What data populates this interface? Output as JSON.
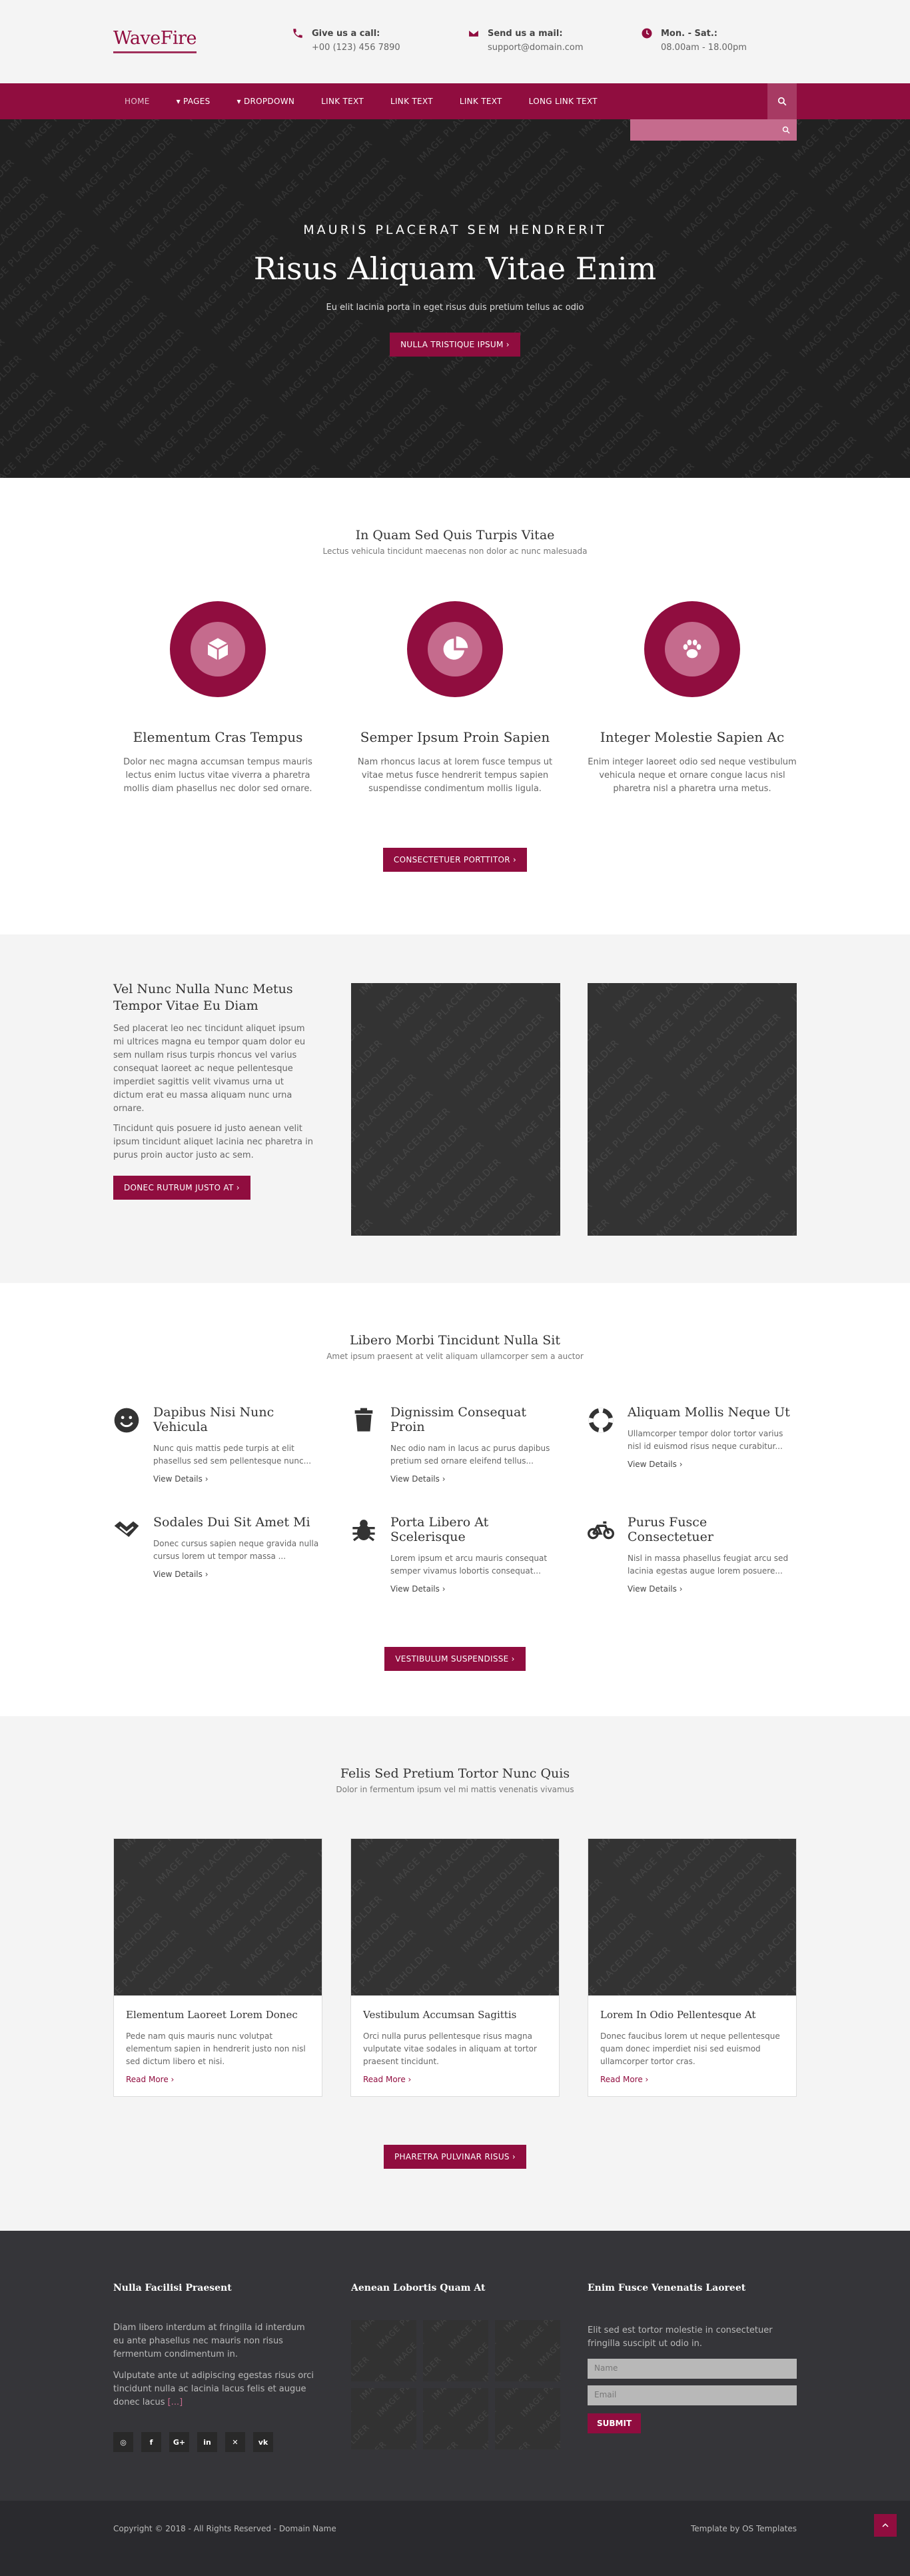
{
  "header": {
    "logo": "WaveFire",
    "contacts": [
      {
        "title": "Give us a call:",
        "value": "+00 (123) 456 7890"
      },
      {
        "title": "Send us a mail:",
        "value": "support@domain.com"
      },
      {
        "title": "Mon. - Sat.:",
        "value": "08.00am - 18.00pm"
      }
    ]
  },
  "nav": {
    "items": [
      "HOME",
      "▾ PAGES",
      "▾ DROPDOWN",
      "LINK TEXT",
      "LINK TEXT",
      "LINK TEXT",
      "LONG LINK TEXT"
    ]
  },
  "placeholder": {
    "text": "IMAGE PLACEHOLDER"
  },
  "hero": {
    "kicker": "MAURIS PLACERAT SEM HENDRERIT",
    "title": "Risus Aliquam Vitae Enim",
    "subtitle": "Eu elit lacinia porta in eget risus duis pretium tellus ac odio",
    "button": "NULLA TRISTIQUE IPSUM ›"
  },
  "features": {
    "title": "In Quam Sed Quis Turpis Vitae",
    "subtitle": "Lectus vehicula tincidunt maecenas non dolor ac nunc malesuada",
    "items": [
      {
        "title": "Elementum Cras Tempus",
        "text": "Dolor nec magna accumsan tempus mauris lectus enim luctus vitae viverra a pharetra mollis diam phasellus nec dolor sed ornare.",
        "icon": "box-icon"
      },
      {
        "title": "Semper Ipsum Proin Sapien",
        "text": "Nam rhoncus lacus at lorem fusce tempus ut vitae metus fusce hendrerit tempus sapien suspendisse condimentum mollis ligula.",
        "icon": "pie-chart-icon"
      },
      {
        "title": "Integer Molestie Sapien Ac",
        "text": "Enim integer laoreet odio sed neque vestibulum vehicula neque et ornare congue lacus nisl pharetra nisl a pharetra urna metus.",
        "icon": "paw-icon"
      }
    ],
    "button": "CONSECTETUER PORTTITOR ›"
  },
  "about": {
    "title": "Vel Nunc Nulla Nunc Metus Tempor Vitae Eu Diam",
    "para1": "Sed placerat leo nec tincidunt aliquet ipsum mi ultrices magna eu tempor quam dolor eu sem nullam risus turpis rhoncus vel varius consequat laoreet ac neque pellentesque imperdiet sagittis velit vivamus urna ut dictum erat eu massa aliquam nunc urna ornare.",
    "para2": "Tincidunt quis posuere id justo aenean velit ipsum tincidunt aliquet lacinia nec pharetra in purus proin auctor justo ac sem.",
    "button": "DONEC RUTRUM JUSTO AT ›"
  },
  "services": {
    "title": "Libero Morbi Tincidunt Nulla Sit",
    "subtitle": "Amet ipsum praesent at velit aliquam ullamcorper sem a auctor",
    "more": "View Details ›",
    "items": [
      {
        "title": "Dapibus Nisi Nunc Vehicula",
        "text": "Nunc quis mattis pede turpis at elit phasellus sed sem pellentesque nunc...",
        "icon": "smile-icon"
      },
      {
        "title": "Dignissim Consequat Proin",
        "text": "Nec odio nam in lacus ac purus dapibus pretium sed ornare eleifend tellus...",
        "icon": "trash-icon"
      },
      {
        "title": "Aliquam Mollis Neque Ut",
        "text": "Ullamcorper tempor dolor tortor varius nisl id euismod risus neque curabitur...",
        "icon": "lifebuoy-icon"
      },
      {
        "title": "Sodales Dui Sit Amet Mi",
        "text": "Donec cursus sapien neque gravida nulla cursus lorem ut tempor massa ...",
        "icon": "handshake-icon"
      },
      {
        "title": "Porta Libero At Scelerisque",
        "text": "Lorem ipsum et arcu mauris consequat semper vivamus lobortis consequat...",
        "icon": "bug-icon"
      },
      {
        "title": "Purus Fusce Consectetuer",
        "text": "Nisl in massa phasellus feugiat arcu sed lacinia egestas augue lorem posuere...",
        "icon": "bicycle-icon"
      }
    ],
    "button": "VESTIBULUM SUSPENDISSE ›"
  },
  "blog": {
    "title": "Felis Sed Pretium Tortor Nunc Quis",
    "subtitle": "Dolor in fermentum ipsum vel mi mattis venenatis vivamus",
    "more": "Read More ›",
    "cards": [
      {
        "title": "Elementum Laoreet Lorem Donec",
        "text": "Pede nam quis mauris nunc volutpat elementum sapien in hendrerit justo non nisl sed dictum libero et nisi."
      },
      {
        "title": "Vestibulum Accumsan Sagittis",
        "text": "Orci nulla purus pellentesque risus magna vulputate vitae sodales in aliquam at tortor praesent tincidunt."
      },
      {
        "title": "Lorem In Odio Pellentesque At",
        "text": "Donec faucibus lorem ut neque pellentesque quam donec imperdiet nisi sed euismod ullamcorper tortor cras."
      }
    ],
    "button": "PHARETRA PULVINAR RISUS ›"
  },
  "footer": {
    "col1": {
      "title": "Nulla Facilisi Praesent",
      "para1": "Diam libero interdum at fringilla id interdum eu ante phasellus nec mauris non risus fermentum condimentum in.",
      "para2": "Vulputate ante ut adipiscing egestas risus orci tincidunt nulla ac lacinia lacus felis et augue donec lacus",
      "para2_link": "[...]"
    },
    "col2": {
      "title": "Aenean Lobortis Quam At"
    },
    "col3": {
      "title": "Enim Fusce Venenatis Laoreet",
      "text": "Elit sed est tortor molestie in consectetuer fringilla suscipit ut odio in.",
      "name_placeholder": "Name",
      "email_placeholder": "Email",
      "button": "SUBMIT"
    },
    "social": [
      "dribbble",
      "facebook",
      "G+",
      "in",
      "twitter",
      "vk"
    ],
    "copyright": "Copyright © 2018 - All Rights Reserved - Domain Name",
    "credit": "Template by OS Templates"
  },
  "colors": {
    "brand": "#900d3f",
    "brand_light": "#c56b8d",
    "dark": "#212121",
    "footer": "#353539"
  }
}
